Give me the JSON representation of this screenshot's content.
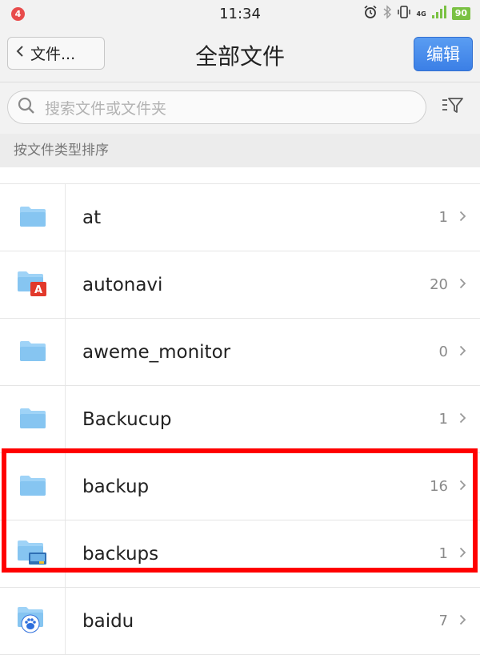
{
  "status_bar": {
    "notification_count": "4",
    "time": "11:34",
    "network": "4G",
    "battery": "90"
  },
  "nav": {
    "back_label": "文件...",
    "title": "全部文件",
    "edit_label": "编辑"
  },
  "search": {
    "placeholder": "搜索文件或文件夹"
  },
  "sort_header": "按文件类型排序",
  "files": [
    {
      "name": "at",
      "count": "1",
      "icon": "folder-icon"
    },
    {
      "name": "autonavi",
      "count": "20",
      "icon": "autonavi-folder-icon"
    },
    {
      "name": "aweme_monitor",
      "count": "0",
      "icon": "folder-icon"
    },
    {
      "name": "Backucup",
      "count": "1",
      "icon": "folder-icon"
    },
    {
      "name": "backup",
      "count": "16",
      "icon": "folder-icon"
    },
    {
      "name": "backups",
      "count": "1",
      "icon": "backup-folder-icon"
    },
    {
      "name": "baidu",
      "count": "7",
      "icon": "baidu-folder-icon"
    }
  ],
  "colors": {
    "accent": "#3b7fe6",
    "highlight": "#ff0000",
    "folder": "#8ec9f2"
  }
}
